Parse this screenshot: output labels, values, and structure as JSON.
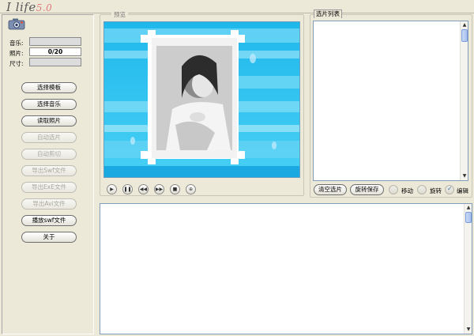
{
  "app": {
    "logo_main": "I life",
    "logo_version": "5.0"
  },
  "info": {
    "music_label": "音乐:",
    "music_value": "",
    "photo_label": "照片:",
    "photo_value": "0/20",
    "size_label": "尺寸:",
    "size_value": ""
  },
  "left_buttons": [
    {
      "label": "选择模板",
      "enabled": true
    },
    {
      "label": "选择音乐",
      "enabled": true
    },
    {
      "label": "读取照片",
      "enabled": true
    },
    {
      "label": "自动选片",
      "enabled": false
    },
    {
      "label": "自动剪切",
      "enabled": false
    },
    {
      "label": "导出Swf文件",
      "enabled": false
    },
    {
      "label": "导出ExE文件",
      "enabled": false
    },
    {
      "label": "导出Avi文件",
      "enabled": false
    },
    {
      "label": "播放swf文件",
      "enabled": true
    },
    {
      "label": "关于",
      "enabled": true
    }
  ],
  "preview": {
    "legend": "预览"
  },
  "playback_icons": [
    "play-icon",
    "pause-icon",
    "rewind-icon",
    "forward-icon",
    "stop-icon",
    "zoom-icon"
  ],
  "photo_list": {
    "legend": "选片列表"
  },
  "list_controls": {
    "clear_label": "清空选片",
    "rotate_save_label": "旋转保存",
    "move_label": "移动",
    "rotate_label": "旋转",
    "edit_label": "编辑",
    "selected_mode": "edit"
  },
  "colors": {
    "window_bg": "#ece9d8",
    "preview_sky": "#29c6f0",
    "scroll_thumb": "#a9c1ee"
  }
}
